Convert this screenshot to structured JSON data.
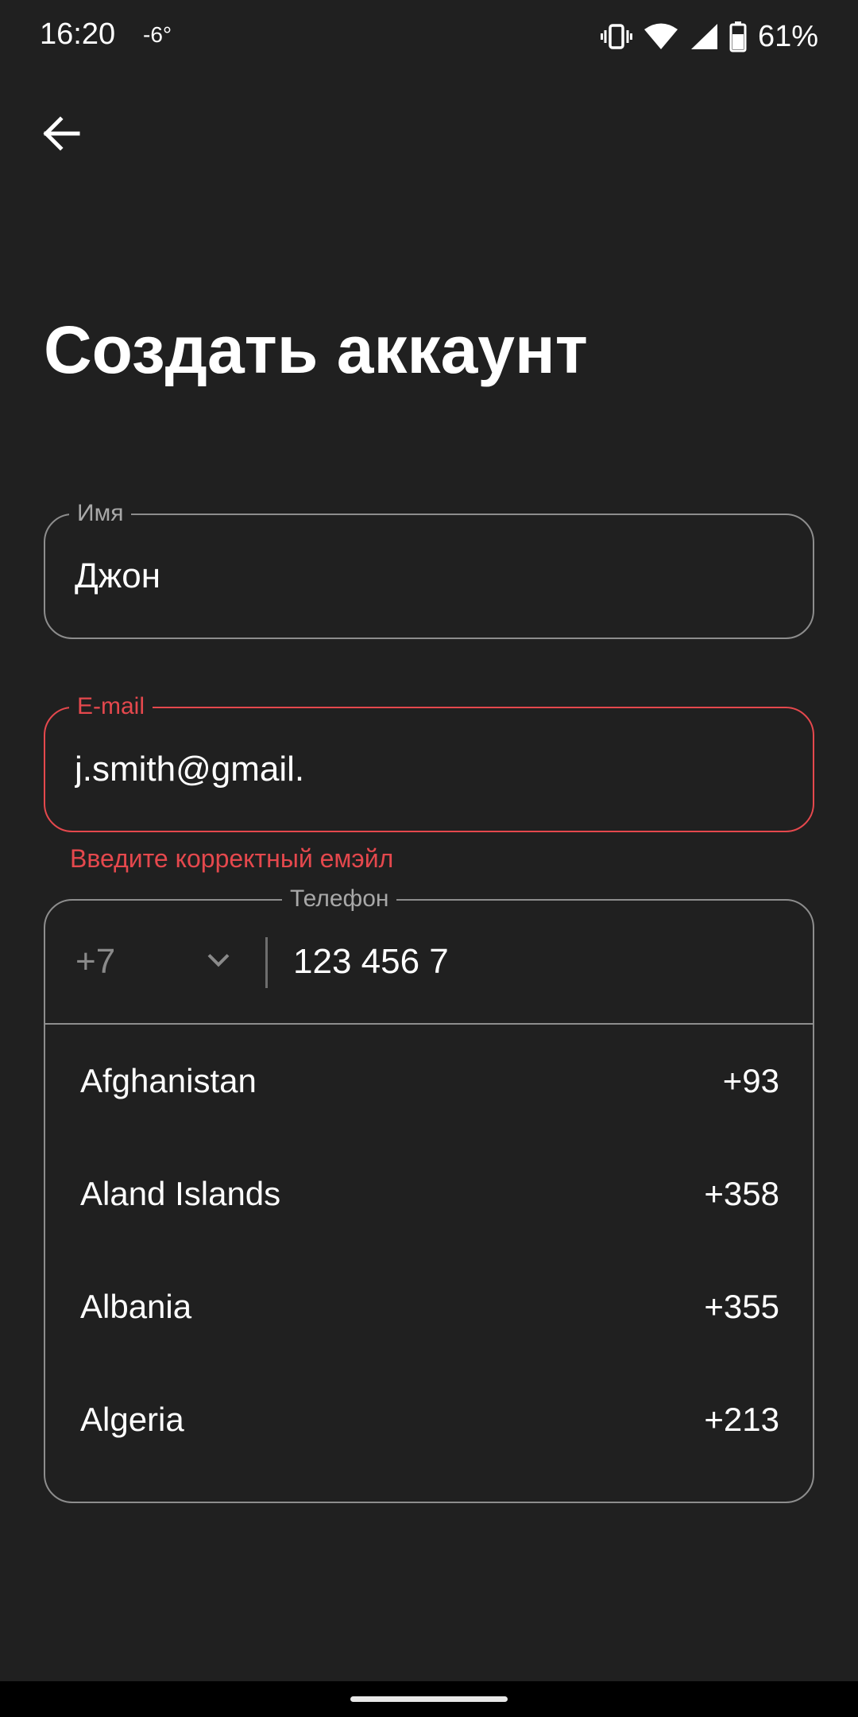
{
  "status_bar": {
    "time": "16:20",
    "temperature": "-6°",
    "battery_percent": "61%",
    "icons": [
      "vibrate-icon",
      "wifi-icon",
      "signal-icon",
      "battery-icon"
    ]
  },
  "header": {
    "back_icon": "arrow-left-icon",
    "title": "Создать аккаунт"
  },
  "form": {
    "name": {
      "label": "Имя",
      "value": "Джон"
    },
    "email": {
      "label": "E-mail",
      "value": "j.smith@gmail.",
      "error": "Введите корректный емэйл"
    },
    "phone": {
      "label": "Телефон",
      "country_code": "+7",
      "value": "123 456 7"
    }
  },
  "country_dropdown": {
    "items": [
      {
        "name": "Afghanistan",
        "code": "+93"
      },
      {
        "name": "Aland Islands",
        "code": "+358"
      },
      {
        "name": "Albania",
        "code": "+355"
      },
      {
        "name": "Algeria",
        "code": "+213"
      }
    ]
  },
  "colors": {
    "background": "#202020",
    "error": "#e5484d",
    "outline": "#8d8d8d",
    "text": "#ffffff"
  }
}
